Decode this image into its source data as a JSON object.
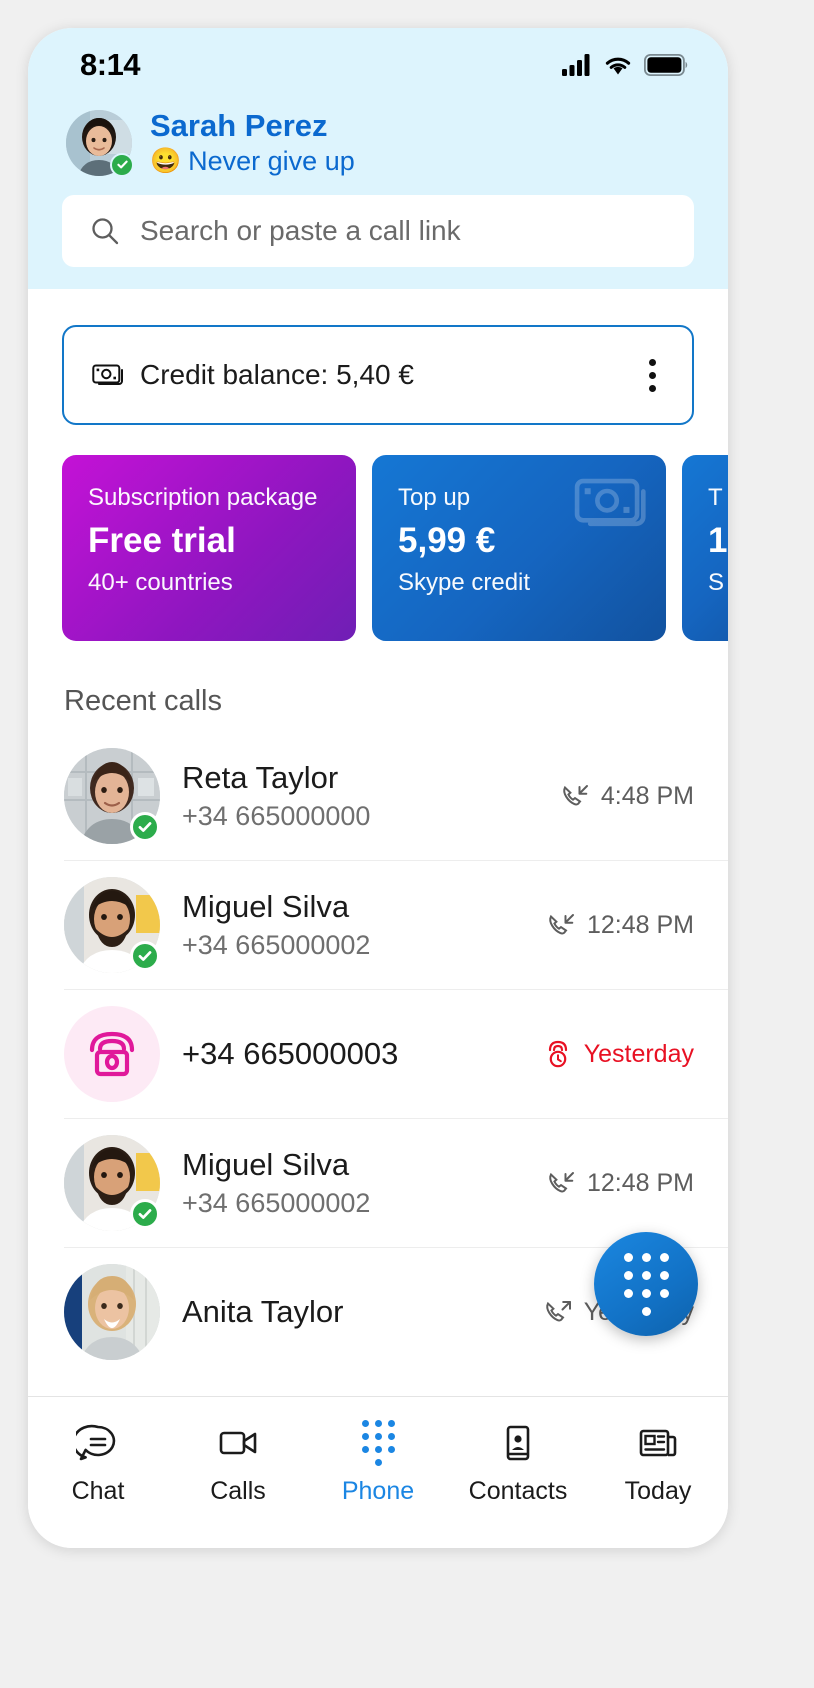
{
  "status_bar": {
    "time": "8:14",
    "icons": [
      "signal-bars-icon",
      "wifi-icon",
      "battery-full-icon"
    ]
  },
  "profile": {
    "name": "Sarah Perez",
    "mood_emoji": "😀",
    "mood": "Never give up",
    "presence": "online",
    "avatar_icon": "user-avatar"
  },
  "search": {
    "placeholder": "Search or paste a call link",
    "icon": "search-icon"
  },
  "credit": {
    "icon": "banknote-icon",
    "label": "Credit balance: 5,40 €",
    "menu_icon": "more-vertical-icon",
    "border_color": "#1277c8"
  },
  "promos": [
    {
      "label": "Subscription package",
      "title": "Free trial",
      "sub": "40+ countries",
      "color": "#8f16c0",
      "watermark": ""
    },
    {
      "label": "Top up",
      "title": "5,99 €",
      "sub": "Skype credit",
      "color": "#1565c0",
      "watermark": "banknote-icon"
    },
    {
      "label": "T",
      "title": "1",
      "sub": "S",
      "color": "#1565c0",
      "watermark": ""
    }
  ],
  "recent": {
    "title": "Recent calls",
    "calls": [
      {
        "name": "Reta Taylor",
        "number": "+34 665000000",
        "time": "4:48 PM",
        "direction": "incoming",
        "direction_icon": "call-incoming-icon",
        "avatar_type": "photo",
        "presence": "online",
        "missed": false
      },
      {
        "name": "Miguel Silva",
        "number": "+34 665000002",
        "time": "12:48 PM",
        "direction": "incoming",
        "direction_icon": "call-incoming-icon",
        "avatar_type": "photo",
        "presence": "online",
        "missed": false
      },
      {
        "name": "+34 665000003",
        "number": "",
        "time": "Yesterday",
        "direction": "missed",
        "direction_icon": "call-missed-icon",
        "avatar_type": "landline",
        "presence": "none",
        "missed": true
      },
      {
        "name": "Miguel Silva",
        "number": "+34 665000002",
        "time": "12:48 PM",
        "direction": "incoming",
        "direction_icon": "call-incoming-icon",
        "avatar_type": "photo",
        "presence": "online",
        "missed": false
      },
      {
        "name": "Anita Taylor",
        "number": "",
        "time": "Yesterday",
        "direction": "outgoing",
        "direction_icon": "call-outgoing-icon",
        "avatar_type": "photo",
        "presence": "none",
        "missed": false
      }
    ]
  },
  "fab": {
    "icon": "dialpad-icon",
    "color": "#1272c6"
  },
  "bottom_nav": {
    "active": "Phone",
    "items": [
      {
        "label": "Chat",
        "icon": "chat-bubble-icon"
      },
      {
        "label": "Calls",
        "icon": "video-camera-icon"
      },
      {
        "label": "Phone",
        "icon": "dialpad-icon"
      },
      {
        "label": "Contacts",
        "icon": "contact-card-icon"
      },
      {
        "label": "Today",
        "icon": "newspaper-icon"
      }
    ]
  }
}
